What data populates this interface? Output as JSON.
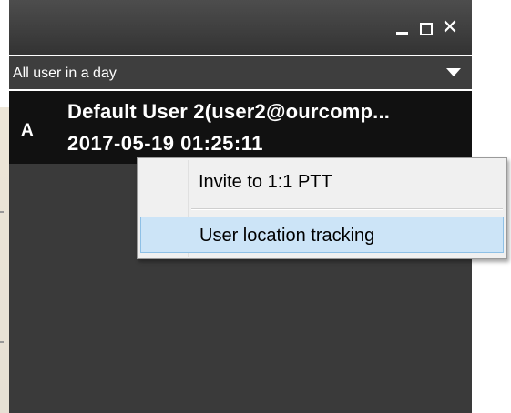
{
  "window": {
    "controls": {
      "minimize_icon": "minimize-icon",
      "maximize_icon": "maximize-icon",
      "close_icon": "close-icon",
      "close_glyph": "✕"
    }
  },
  "filter": {
    "selected": "All user in a day",
    "arrow_icon": "chevron-down-icon"
  },
  "user_list": [
    {
      "avatar_letter": "A",
      "name": "Default User 2(user2@ourcomp...",
      "timestamp": "2017-05-19 01:25:11"
    }
  ],
  "context_menu": {
    "items": [
      {
        "label": "Invite to 1:1 PTT"
      },
      {
        "label": "User location tracking",
        "highlighted": true
      }
    ]
  },
  "colors": {
    "titlebar": "#3d3d3d",
    "panel": "#3a3a3a",
    "selected_row": "#111111",
    "menu_bg": "#f0f0f0",
    "menu_highlight": "#cce4f7",
    "menu_highlight_border": "#8ec0e6"
  }
}
